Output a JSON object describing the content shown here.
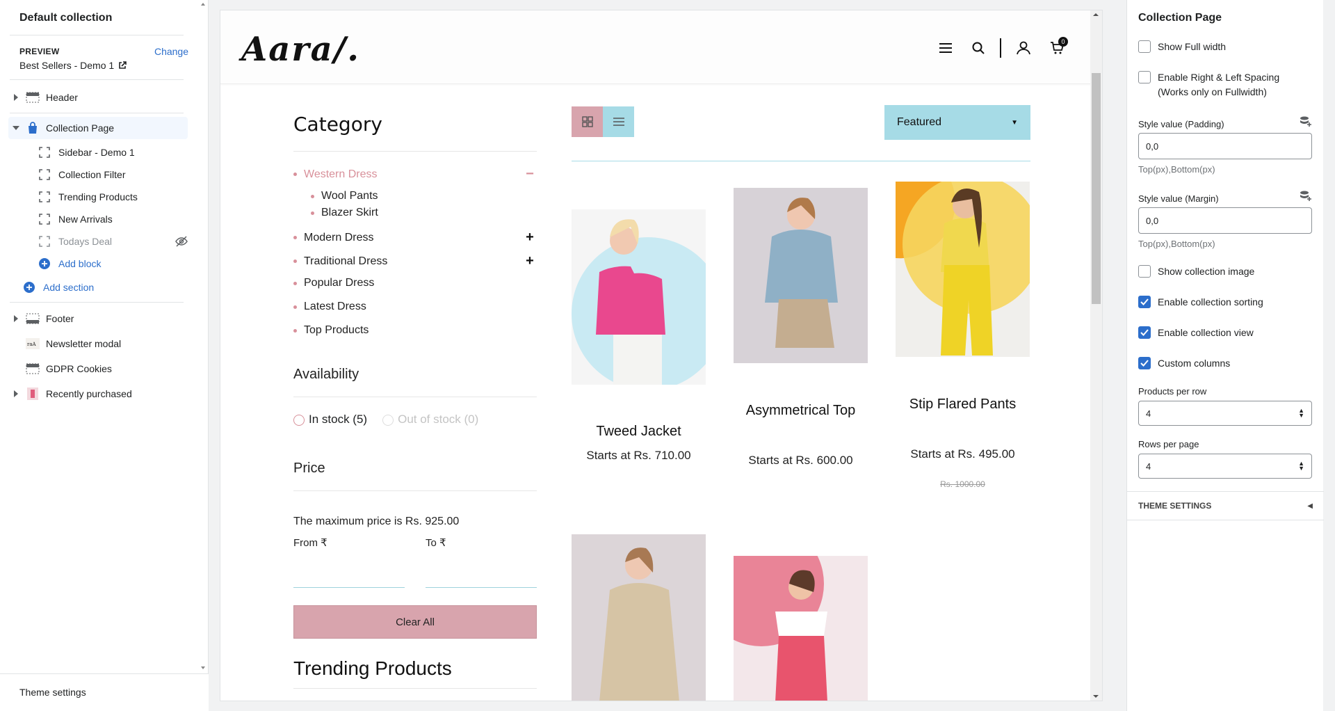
{
  "left": {
    "title": "Default collection",
    "preview_label": "PREVIEW",
    "preview_value": "Best Sellers - Demo 1",
    "change_link": "Change",
    "header": "Header",
    "collection_page": "Collection Page",
    "blocks": [
      "Sidebar - Demo 1",
      "Collection Filter",
      "Trending Products",
      "New Arrivals",
      "Todays Deal"
    ],
    "add_block": "Add block",
    "add_section": "Add section",
    "footer": "Footer",
    "newsletter": "Newsletter modal",
    "gdpr": "GDPR Cookies",
    "recently": "Recently purchased",
    "theme_settings": "Theme settings"
  },
  "store": {
    "logo": "Aara/.",
    "cart_count": "0",
    "category_title": "Category",
    "categories": [
      {
        "label": "Western Dress",
        "sign": "−"
      },
      {
        "label": "Modern Dress",
        "sign": "+"
      },
      {
        "label": "Traditional Dress",
        "sign": "+"
      },
      {
        "label": "Popular Dress",
        "sign": ""
      },
      {
        "label": "Latest Dress",
        "sign": ""
      },
      {
        "label": "Top Products",
        "sign": ""
      }
    ],
    "sub_categories": [
      "Wool Pants",
      "Blazer Skirt"
    ],
    "availability_title": "Availability",
    "in_stock": "In stock (5)",
    "out_of_stock": "Out of stock (0)",
    "price_title": "Price",
    "max_price": "The maximum price is Rs. 925.00",
    "from_label": "From ₹",
    "to_label": "To ₹",
    "clear_all": "Clear All",
    "trending_title": "Trending Products",
    "sort_value": "Featured",
    "products": [
      {
        "name": "Tweed Jacket",
        "price": "Starts at Rs. 710.00",
        "old_price": ""
      },
      {
        "name": "Asymmetrical Top",
        "price": "Starts at Rs. 600.00",
        "old_price": ""
      },
      {
        "name": "Stip Flared Pants",
        "price": "Starts at Rs. 495.00",
        "old_price": "Rs. 1000.00"
      }
    ]
  },
  "right": {
    "title": "Collection Page",
    "show_full_width": "Show Full width",
    "enable_spacing": "Enable Right & Left Spacing (Works only on Fullwidth)",
    "padding_label": "Style value (Padding)",
    "padding_value": "0,0",
    "padding_help": "Top(px),Bottom(px)",
    "margin_label": "Style value (Margin)",
    "margin_value": "0,0",
    "margin_help": "Top(px),Bottom(px)",
    "show_image": "Show collection image",
    "enable_sorting": "Enable collection sorting",
    "enable_view": "Enable collection view",
    "custom_columns": "Custom columns",
    "products_per_row_label": "Products per row",
    "products_per_row": "4",
    "rows_per_page_label": "Rows per page",
    "rows_per_page": "4",
    "theme_settings": "THEME SETTINGS"
  },
  "colors": {
    "accent": "#2c6ecb",
    "pink": "#d8a4ad",
    "teal": "#a6dbe6"
  }
}
